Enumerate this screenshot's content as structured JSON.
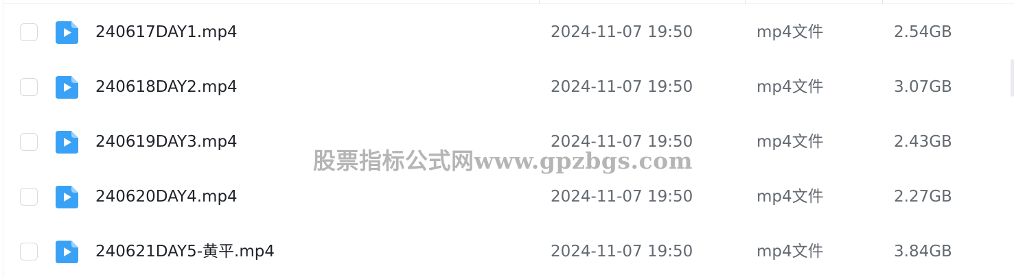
{
  "colors": {
    "icon_blue": "#3aa2f6",
    "icon_fold": "#9dd0fb",
    "name_text": "#1f2329",
    "meta_text": "#636970"
  },
  "files": [
    {
      "name": "240617DAY1.mp4",
      "modified": "2024-11-07 19:50",
      "type": "mp4文件",
      "size": "2.54GB",
      "icon": "video-file-icon"
    },
    {
      "name": "240618DAY2.mp4",
      "modified": "2024-11-07 19:50",
      "type": "mp4文件",
      "size": "3.07GB",
      "icon": "video-file-icon"
    },
    {
      "name": "240619DAY3.mp4",
      "modified": "2024-11-07 19:50",
      "type": "mp4文件",
      "size": "2.43GB",
      "icon": "video-file-icon"
    },
    {
      "name": "240620DAY4.mp4",
      "modified": "2024-11-07 19:50",
      "type": "mp4文件",
      "size": "2.27GB",
      "icon": "video-file-icon"
    },
    {
      "name": "240621DAY5-黄平.mp4",
      "modified": "2024-11-07 19:50",
      "type": "mp4文件",
      "size": "3.84GB",
      "icon": "video-file-icon"
    }
  ],
  "watermark": "股票指标公式网www.gpzbgs.com"
}
